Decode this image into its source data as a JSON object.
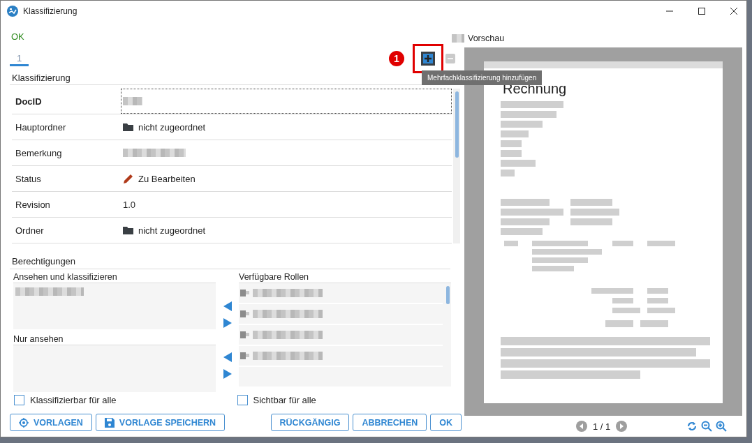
{
  "window": {
    "title": "Klassifizierung"
  },
  "status_text": "OK",
  "tabs": [
    {
      "label": "1",
      "selected": true
    }
  ],
  "toolbar": {
    "annotation": "1",
    "buttons": [
      {
        "kind": "add",
        "highlighted": true,
        "disabled": false
      },
      {
        "kind": "remove",
        "highlighted": false,
        "disabled": true
      }
    ],
    "tooltip": "Mehrfachklassifizierung hinzufügen"
  },
  "classification": {
    "title": "Klassifizierung",
    "fields": [
      {
        "label": "DocID",
        "kind": "redacted",
        "bold": true,
        "focused": true
      },
      {
        "label": "Hauptordner",
        "kind": "folder",
        "value": "nicht zugeordnet",
        "bold": false,
        "focused": false
      },
      {
        "label": "Bemerkung",
        "kind": "redacted",
        "bold": false,
        "focused": false
      },
      {
        "label": "Status",
        "kind": "status",
        "value": "Zu Bearbeiten",
        "bold": false,
        "focused": false
      },
      {
        "label": "Revision",
        "kind": "text",
        "value": "1.0",
        "bold": false,
        "focused": false
      },
      {
        "label": "Ordner",
        "kind": "folder",
        "value": "nicht zugeordnet",
        "bold": false,
        "focused": false
      }
    ]
  },
  "permissions": {
    "title": "Berechtigungen",
    "view_and_classify": {
      "title": "Ansehen und klassifizieren",
      "items": [
        {
          "kind": "redacted"
        }
      ]
    },
    "view_only": {
      "title": "Nur ansehen"
    },
    "available_roles": {
      "title": "Verfügbare Rollen",
      "items": [
        {
          "kind": "redacted"
        },
        {
          "kind": "redacted"
        },
        {
          "kind": "redacted"
        },
        {
          "kind": "redacted"
        }
      ]
    },
    "checkboxes": [
      {
        "label": "Klassifizierbar für alle",
        "checked": false
      },
      {
        "label": "Sichtbar für alle",
        "checked": false
      }
    ]
  },
  "buttons_left": [
    {
      "label": "VORLAGEN",
      "kind": "target"
    },
    {
      "label": "VORLAGE SPEICHERN",
      "kind": "save"
    }
  ],
  "buttons_right": [
    {
      "label": "RÜCKGÄNGIG"
    },
    {
      "label": "ABBRECHEN"
    },
    {
      "label": "OK"
    }
  ],
  "preview": {
    "title": "Vorschau",
    "document_heading": "Rechnung",
    "pager": "1 / 1"
  }
}
